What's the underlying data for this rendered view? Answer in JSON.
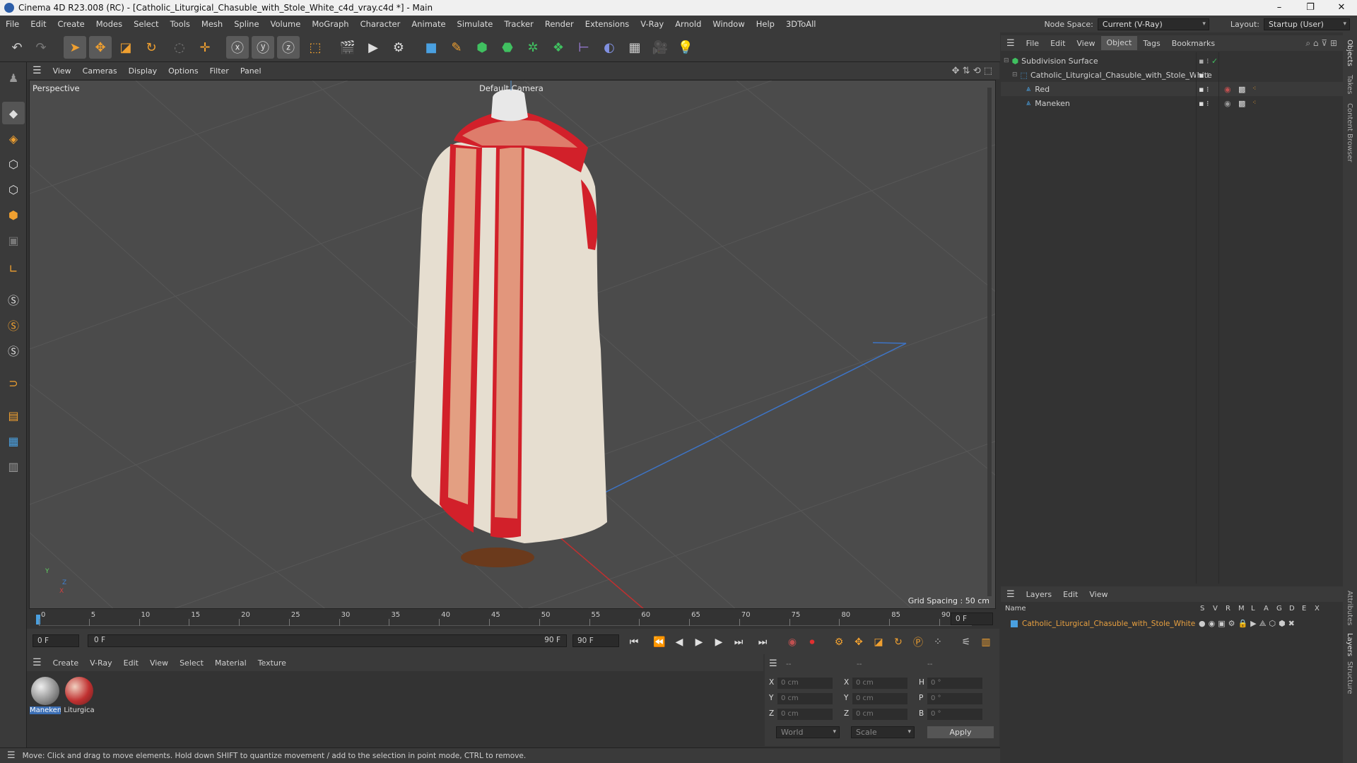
{
  "window": {
    "title": "Cinema 4D R23.008 (RC) - [Catholic_Liturgical_Chasuble_with_Stole_White_c4d_vray.c4d *] - Main",
    "controls": [
      "–",
      "❐",
      "✕"
    ]
  },
  "menubar": {
    "items": [
      "File",
      "Edit",
      "Create",
      "Modes",
      "Select",
      "Tools",
      "Mesh",
      "Spline",
      "Volume",
      "MoGraph",
      "Character",
      "Animate",
      "Simulate",
      "Tracker",
      "Render",
      "Extensions",
      "V-Ray",
      "Arnold",
      "Window",
      "Help",
      "3DToAll"
    ],
    "node_space_label": "Node Space:",
    "node_space_value": "Current (V-Ray)",
    "layout_label": "Layout:",
    "layout_value": "Startup (User)"
  },
  "viewport": {
    "menu": [
      "View",
      "Cameras",
      "Display",
      "Options",
      "Filter",
      "Panel"
    ],
    "view_name": "Perspective",
    "camera_label": "Default Camera",
    "grid_spacing": "Grid Spacing : 50 cm",
    "axis_y": "Y",
    "axis_z": "Z",
    "axis_x": "X",
    "colors": {
      "background": "#4b4b4b",
      "grid": "#5a5a5a",
      "robe_white": "#e6ded0",
      "robe_red": "#d2202a",
      "pattern": "#e8c9a0"
    }
  },
  "timeline": {
    "ticks": [
      "0",
      "5",
      "10",
      "15",
      "20",
      "25",
      "30",
      "35",
      "40",
      "45",
      "50",
      "55",
      "60",
      "65",
      "70",
      "75",
      "80",
      "85",
      "90"
    ],
    "current_frame": "0 F",
    "start": "0 F",
    "range_start": "0 F",
    "range_end": "90 F",
    "end": "90 F"
  },
  "material_manager": {
    "menu": [
      "Create",
      "V-Ray",
      "Edit",
      "View",
      "Select",
      "Material",
      "Texture"
    ],
    "materials": [
      {
        "name": "Maneken"
      },
      {
        "name": "Liturgica"
      }
    ]
  },
  "coordinates": {
    "header": [
      "--",
      "--",
      "--"
    ],
    "rows": [
      {
        "l1": "X",
        "v1": "0 cm",
        "l2": "X",
        "v2": "0 cm",
        "l3": "H",
        "v3": "0 °"
      },
      {
        "l1": "Y",
        "v1": "0 cm",
        "l2": "Y",
        "v2": "0 cm",
        "l3": "P",
        "v3": "0 °"
      },
      {
        "l1": "Z",
        "v1": "0 cm",
        "l2": "Z",
        "v2": "0 cm",
        "l3": "B",
        "v3": "0 °"
      }
    ],
    "world": "World",
    "scale": "Scale",
    "apply": "Apply"
  },
  "status": "Move: Click and drag to move elements. Hold down SHIFT to quantize movement / add to the selection in point mode, CTRL to remove.",
  "object_manager": {
    "menu": [
      "File",
      "Edit",
      "View",
      "Object",
      "Tags",
      "Bookmarks"
    ],
    "objects": [
      {
        "name": "Subdivision Surface",
        "indent": 0
      },
      {
        "name": "Catholic_Liturgical_Chasuble_with_Stole_White",
        "indent": 1
      },
      {
        "name": "Red",
        "indent": 2
      },
      {
        "name": "Maneken",
        "indent": 2
      }
    ]
  },
  "layer_manager": {
    "menu": [
      "Layers",
      "Edit",
      "View"
    ],
    "columns_name": "Name",
    "columns": [
      "S",
      "V",
      "R",
      "M",
      "L",
      "A",
      "G",
      "D",
      "E",
      "X"
    ],
    "layers": [
      {
        "name": "Catholic_Liturgical_Chasuble_with_Stole_White",
        "color": "#e8a040"
      }
    ]
  },
  "right_tabs": [
    "Objects",
    "Takes",
    "Content Browser",
    "Attributes",
    "Layers",
    "Structure"
  ]
}
